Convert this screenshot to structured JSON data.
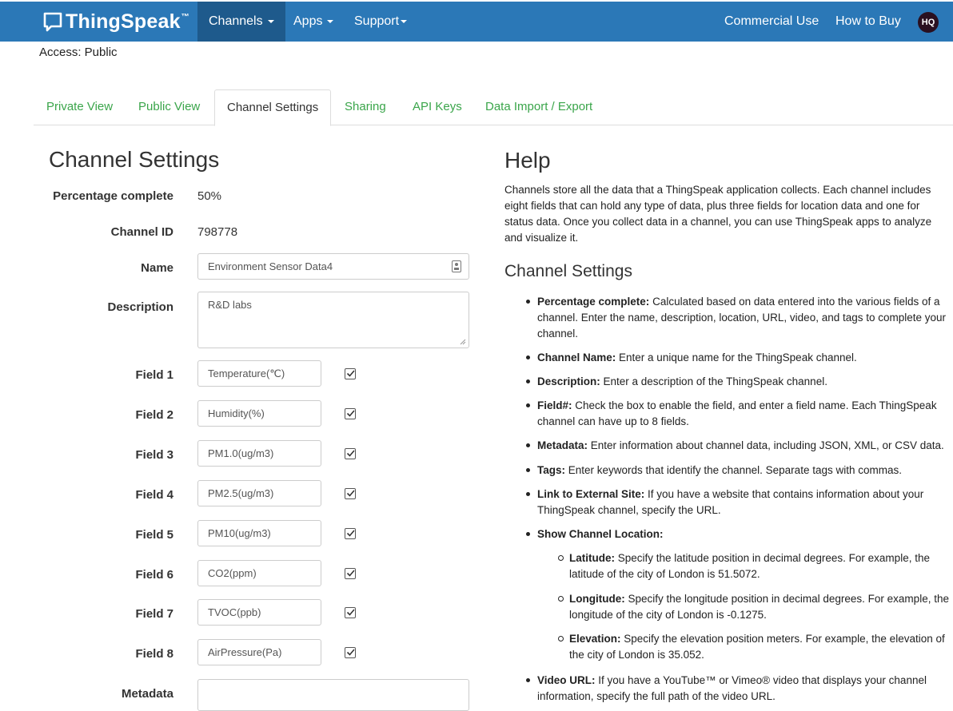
{
  "nav": {
    "brand": "ThingSpeak",
    "brand_tm": "™",
    "items": [
      "Channels",
      "Apps",
      "Support"
    ],
    "right": [
      "Commercial Use",
      "How to Buy"
    ],
    "avatar": "HQ"
  },
  "access": "Access: Public",
  "tabs": [
    "Private View",
    "Public View",
    "Channel Settings",
    "Sharing",
    "API Keys",
    "Data Import / Export"
  ],
  "active_tab": "Channel Settings",
  "settings": {
    "heading": "Channel Settings",
    "percentage_label": "Percentage complete",
    "percentage_value": "50%",
    "channel_id_label": "Channel ID",
    "channel_id_value": "798778",
    "name_label": "Name",
    "name_value": "Environment Sensor Data4",
    "description_label": "Description",
    "description_value": "R&D labs",
    "metadata_label": "Metadata",
    "fields": [
      {
        "label": "Field 1",
        "value": "Temperature(℃)",
        "checked": true
      },
      {
        "label": "Field 2",
        "value": "Humidity(%)",
        "checked": true
      },
      {
        "label": "Field 3",
        "value": "PM1.0(ug/m3)",
        "checked": true
      },
      {
        "label": "Field 4",
        "value": "PM2.5(ug/m3)",
        "checked": true
      },
      {
        "label": "Field 5",
        "value": "PM10(ug/m3)",
        "checked": true
      },
      {
        "label": "Field 6",
        "value": "CO2(ppm)",
        "checked": true
      },
      {
        "label": "Field 7",
        "value": "TVOC(ppb)",
        "checked": true
      },
      {
        "label": "Field 8",
        "value": "AirPressure(Pa)",
        "checked": true
      }
    ]
  },
  "help": {
    "heading": "Help",
    "intro": "Channels store all the data that a ThingSpeak application collects. Each channel includes eight fields that can hold any type of data, plus three fields for location data and one for status data. Once you collect data in a channel, you can use ThingSpeak apps to analyze and visualize it.",
    "settings_heading": "Channel Settings",
    "items": [
      {
        "term": "Percentage complete:",
        "text": " Calculated based on data entered into the various fields of a channel. Enter the name, description, location, URL, video, and tags to complete your channel."
      },
      {
        "term": "Channel Name:",
        "text": " Enter a unique name for the ThingSpeak channel."
      },
      {
        "term": "Description:",
        "text": " Enter a description of the ThingSpeak channel."
      },
      {
        "term": "Field#:",
        "text": " Check the box to enable the field, and enter a field name. Each ThingSpeak channel can have up to 8 fields."
      },
      {
        "term": "Metadata:",
        "text": " Enter information about channel data, including JSON, XML, or CSV data."
      },
      {
        "term": "Tags:",
        "text": " Enter keywords that identify the channel. Separate tags with commas."
      },
      {
        "term": "Link to External Site:",
        "text": " If you have a website that contains information about your ThingSpeak channel, specify the URL."
      },
      {
        "term": "Show Channel Location:",
        "text": ""
      },
      {
        "term": "Video URL:",
        "text": " If you have a YouTube™ or Vimeo® video that displays your channel information, specify the full path of the video URL."
      }
    ],
    "location_items": [
      {
        "term": "Latitude:",
        "text": " Specify the latitude position in decimal degrees. For example, the latitude of the city of London is 51.5072."
      },
      {
        "term": "Longitude:",
        "text": " Specify the longitude position in decimal degrees. For example, the longitude of the city of London is -0.1275."
      },
      {
        "term": "Elevation:",
        "text": " Specify the elevation position meters. For example, the elevation of the city of London is 35.052."
      }
    ]
  }
}
